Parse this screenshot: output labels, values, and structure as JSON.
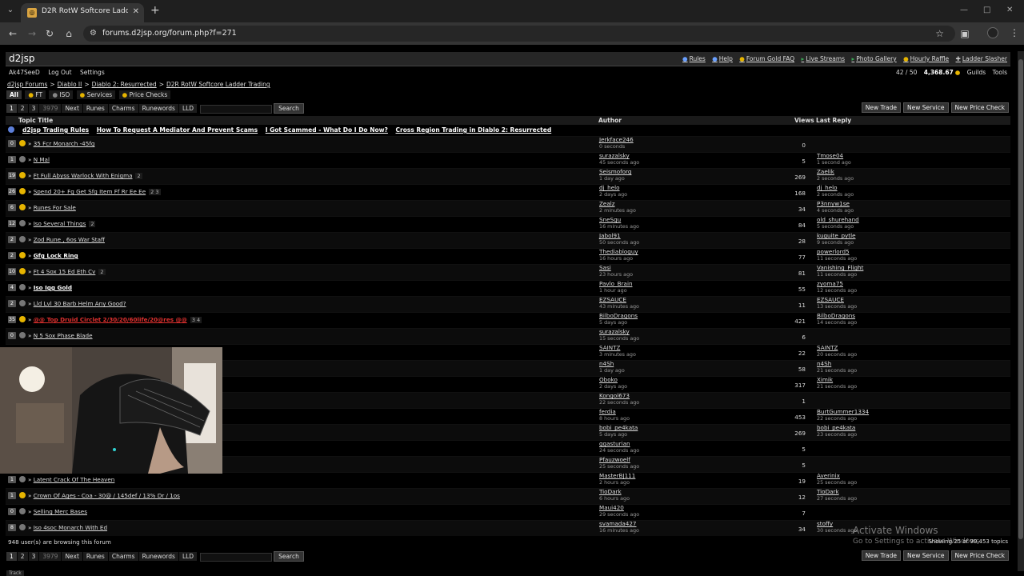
{
  "browser": {
    "tab_title": "D2R RotW Softcore Ladder Trad",
    "url": "forums.d2jsp.org/forum.php?f=271"
  },
  "site": {
    "logo": "d2jsp",
    "top_links": [
      "Rules",
      "Help",
      "Forum Gold FAQ",
      "Live Streams",
      "Photo Gallery",
      "Hourly Raffle",
      "Ladder Slasher"
    ]
  },
  "userbar": {
    "username": "Ak47SeeD",
    "logout": "Log Out",
    "settings": "Settings",
    "messages": "42 / 50",
    "gold": "4,368.67",
    "guilds": "Guilds",
    "tools": "Tools"
  },
  "breadcrumbs": [
    "d2jsp Forums",
    "Diablo II",
    "Diablo 2: Resurrected",
    "D2R RotW Softcore Ladder Trading"
  ],
  "filters": [
    "All",
    "FT",
    "ISO",
    "Services",
    "Price Checks"
  ],
  "pager": {
    "pages": [
      "1",
      "2",
      "3"
    ],
    "total": "3979",
    "next": "Next",
    "quick": [
      "Runes",
      "Charms",
      "Runewords",
      "LLD"
    ],
    "search": "Search"
  },
  "actions": [
    "New Trade",
    "New Service",
    "New Price Check"
  ],
  "table_headers": {
    "topic": "Topic Title",
    "author": "Author",
    "views": "Views",
    "last_reply": "Last Reply"
  },
  "sticky_links": [
    "d2jsp Trading Rules",
    "How To Request A Mediator And Prevent Scams",
    "I Got Scammed - What Do I Do Now?",
    "Cross Region Trading in Diablo 2: Resurrected"
  ],
  "rows": [
    {
      "replies": "0",
      "icon": "gold",
      "title": "35 Fcr Monarch -45fg",
      "style": "",
      "pages": "",
      "author": "Jerkface246",
      "author_time": "0 seconds",
      "views": "0",
      "last": "",
      "last_time": ""
    },
    {
      "replies": "1",
      "icon": "grey",
      "title": "N Mal",
      "style": "",
      "pages": "",
      "author": "surazalsky",
      "author_time": "45 seconds ago",
      "views": "5",
      "last": "Tmose04",
      "last_time": "1 second ago"
    },
    {
      "replies": "19",
      "icon": "gold",
      "title": "Ft Full Abyss Warlock With Enigma",
      "style": "",
      "pages": "2",
      "author": "Seismoforg",
      "author_time": "1 day ago",
      "views": "269",
      "last": "Zaelik",
      "last_time": "2 seconds ago"
    },
    {
      "replies": "26",
      "icon": "gold",
      "title": "Spend 20+ Fg Get Sfg Item Ff Rr Ee Ee",
      "style": "",
      "pages": "2 3",
      "author": "dj_helo",
      "author_time": "2 days ago",
      "views": "168",
      "last": "dj_helo",
      "last_time": "2 seconds ago"
    },
    {
      "replies": "6",
      "icon": "gold",
      "title": "Runes For Sale",
      "style": "",
      "pages": "",
      "author": "Zealz",
      "author_time": "2 minutes ago",
      "views": "34",
      "last": "P3nnyw1se",
      "last_time": "4 seconds ago"
    },
    {
      "replies": "12",
      "icon": "grey",
      "title": "Iso Several Things",
      "style": "",
      "pages": "2",
      "author": "SneSgu",
      "author_time": "16 minutes ago",
      "views": "84",
      "last": "old_shurehand",
      "last_time": "5 seconds ago"
    },
    {
      "replies": "2",
      "icon": "grey",
      "title": "Zod Rune , 6os War Staff",
      "style": "",
      "pages": "",
      "author": "Jabol91",
      "author_time": "50 seconds ago",
      "views": "28",
      "last": "kuguite_pytle",
      "last_time": "9 seconds ago"
    },
    {
      "replies": "2",
      "icon": "gold",
      "title": "Gfg Lock Ring",
      "style": "bold",
      "pages": "",
      "author": "Thediabloguy",
      "author_time": "16 hours ago",
      "views": "77",
      "last": "powerlord5",
      "last_time": "11 seconds ago"
    },
    {
      "replies": "10",
      "icon": "gold",
      "title": "Ft 4 Sox 15 Ed Eth Cv",
      "style": "",
      "pages": "2",
      "author": "Sasi",
      "author_time": "23 hours ago",
      "views": "81",
      "last": "Vanishing_Flight",
      "last_time": "11 seconds ago"
    },
    {
      "replies": "4",
      "icon": "grey",
      "title": "Iso Igg Gold",
      "style": "bold",
      "pages": "",
      "author": "Pavlo_Brain",
      "author_time": "1 hour ago",
      "views": "55",
      "last": "zyoma75",
      "last_time": "12 seconds ago"
    },
    {
      "replies": "2",
      "icon": "grey",
      "title": "Lld Lvl 30 Barb Helm Any Good?",
      "style": "",
      "pages": "",
      "author": "EZSAUCE",
      "author_time": "43 minutes ago",
      "views": "11",
      "last": "EZSAUCE",
      "last_time": "13 seconds ago"
    },
    {
      "replies": "35",
      "icon": "gold",
      "title": "@@ Top Druid Circlet 2/30/20/60life/20@res @@",
      "style": "red",
      "pages": "3 4",
      "author": "BilboDragons",
      "author_time": "5 days ago",
      "views": "421",
      "last": "BilboDragons",
      "last_time": "14 seconds ago"
    },
    {
      "replies": "0",
      "icon": "grey",
      "title": "N 5 Sox Phase Blade",
      "style": "",
      "pages": "",
      "author": "surazalsky",
      "author_time": "15 seconds ago",
      "views": "6",
      "last": "",
      "last_time": ""
    },
    {
      "replies": "",
      "icon": "",
      "title": "",
      "style": "",
      "pages": "",
      "author": "SAINTZ",
      "author_time": "3 minutes ago",
      "views": "22",
      "last": "SAINTZ",
      "last_time": "20 seconds ago"
    },
    {
      "replies": "",
      "icon": "",
      "title": "",
      "style": "",
      "pages": "",
      "author": "n4Sh",
      "author_time": "1 day ago",
      "views": "58",
      "last": "n4Sh",
      "last_time": "21 seconds ago"
    },
    {
      "replies": "",
      "icon": "",
      "title": "",
      "style": "",
      "pages": "",
      "author": "Oboko",
      "author_time": "2 days ago",
      "views": "317",
      "last": "Ximik",
      "last_time": "21 seconds ago"
    },
    {
      "replies": "",
      "icon": "",
      "title": "",
      "style": "",
      "pages": "",
      "author": "Kongol673",
      "author_time": "22 seconds ago",
      "views": "1",
      "last": "",
      "last_time": ""
    },
    {
      "replies": "",
      "icon": "",
      "title": "",
      "style": "",
      "pages": "",
      "author": "ferdia",
      "author_time": "8 hours ago",
      "views": "453",
      "last": "BurtGummer1334",
      "last_time": "22 seconds ago"
    },
    {
      "replies": "",
      "icon": "",
      "title": "",
      "style": "",
      "pages": "",
      "author": "bobi_pe4kata",
      "author_time": "5 days ago",
      "views": "269",
      "last": "bobi_pe4kata",
      "last_time": "23 seconds ago"
    },
    {
      "replies": "",
      "icon": "",
      "title": "",
      "style": "",
      "pages": "",
      "author": "ggasturian",
      "author_time": "24 seconds ago",
      "views": "5",
      "last": "",
      "last_time": ""
    },
    {
      "replies": "",
      "icon": "",
      "title": "",
      "style": "",
      "pages": "",
      "author": "Pfauzwoelf",
      "author_time": "25 seconds ago",
      "views": "5",
      "last": "",
      "last_time": ""
    },
    {
      "replies": "1",
      "icon": "grey",
      "title": "Latent Crack Of The Heaven",
      "style": "",
      "pages": "",
      "author": "MasterBJ111",
      "author_time": "2 hours ago",
      "views": "19",
      "last": "Averinix",
      "last_time": "25 seconds ago"
    },
    {
      "replies": "1",
      "icon": "gold",
      "title": "Crown Of Ages - Coa - 30@ / 145def / 13% Dr / 1os",
      "style": "",
      "pages": "",
      "author": "TioDark",
      "author_time": "6 hours ago",
      "views": "12",
      "last": "TioDark",
      "last_time": "27 seconds ago"
    },
    {
      "replies": "0",
      "icon": "grey",
      "title": "Selling Merc Bases",
      "style": "",
      "pages": "",
      "author": "Maui420",
      "author_time": "29 seconds ago",
      "views": "7",
      "last": "",
      "last_time": ""
    },
    {
      "replies": "8",
      "icon": "grey",
      "title": "Iso 4soc Monarch With Ed",
      "style": "",
      "pages": "",
      "author": "svamada427",
      "author_time": "16 minutes ago",
      "views": "34",
      "last": "stoffy",
      "last_time": "30 seconds ago"
    }
  ],
  "browsing": "948 user(s) are browsing this forum",
  "showing": "Showing 25 of 99,453 topics",
  "watermark": {
    "line1": "Activate Windows",
    "line2": "Go to Settings to activate Windows."
  },
  "track": "Track"
}
